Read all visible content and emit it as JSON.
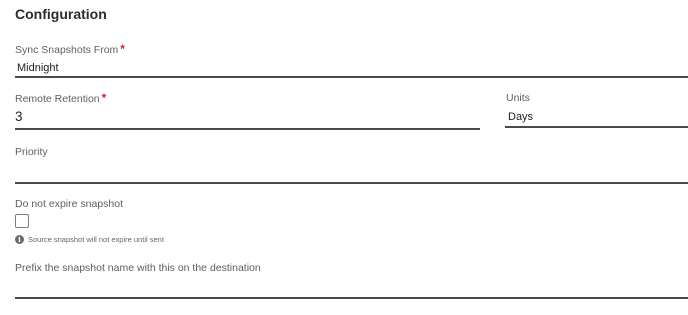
{
  "section": {
    "title": "Configuration"
  },
  "sync_from": {
    "label": "Sync Snapshots From",
    "required_mark": "*",
    "value": "Midnight"
  },
  "remote_retention": {
    "label": "Remote Retention",
    "required_mark": "*",
    "value": "3"
  },
  "units": {
    "label": "Units",
    "value": "Days"
  },
  "priority": {
    "label": "Priority",
    "value": ""
  },
  "no_expire": {
    "label": "Do not expire snapshot",
    "checked": false,
    "hint": "Source snapshot will not expire until sent",
    "hint_icon": "info-icon"
  },
  "prefix": {
    "label": "Prefix the snapshot name with this on the destination",
    "value": ""
  }
}
